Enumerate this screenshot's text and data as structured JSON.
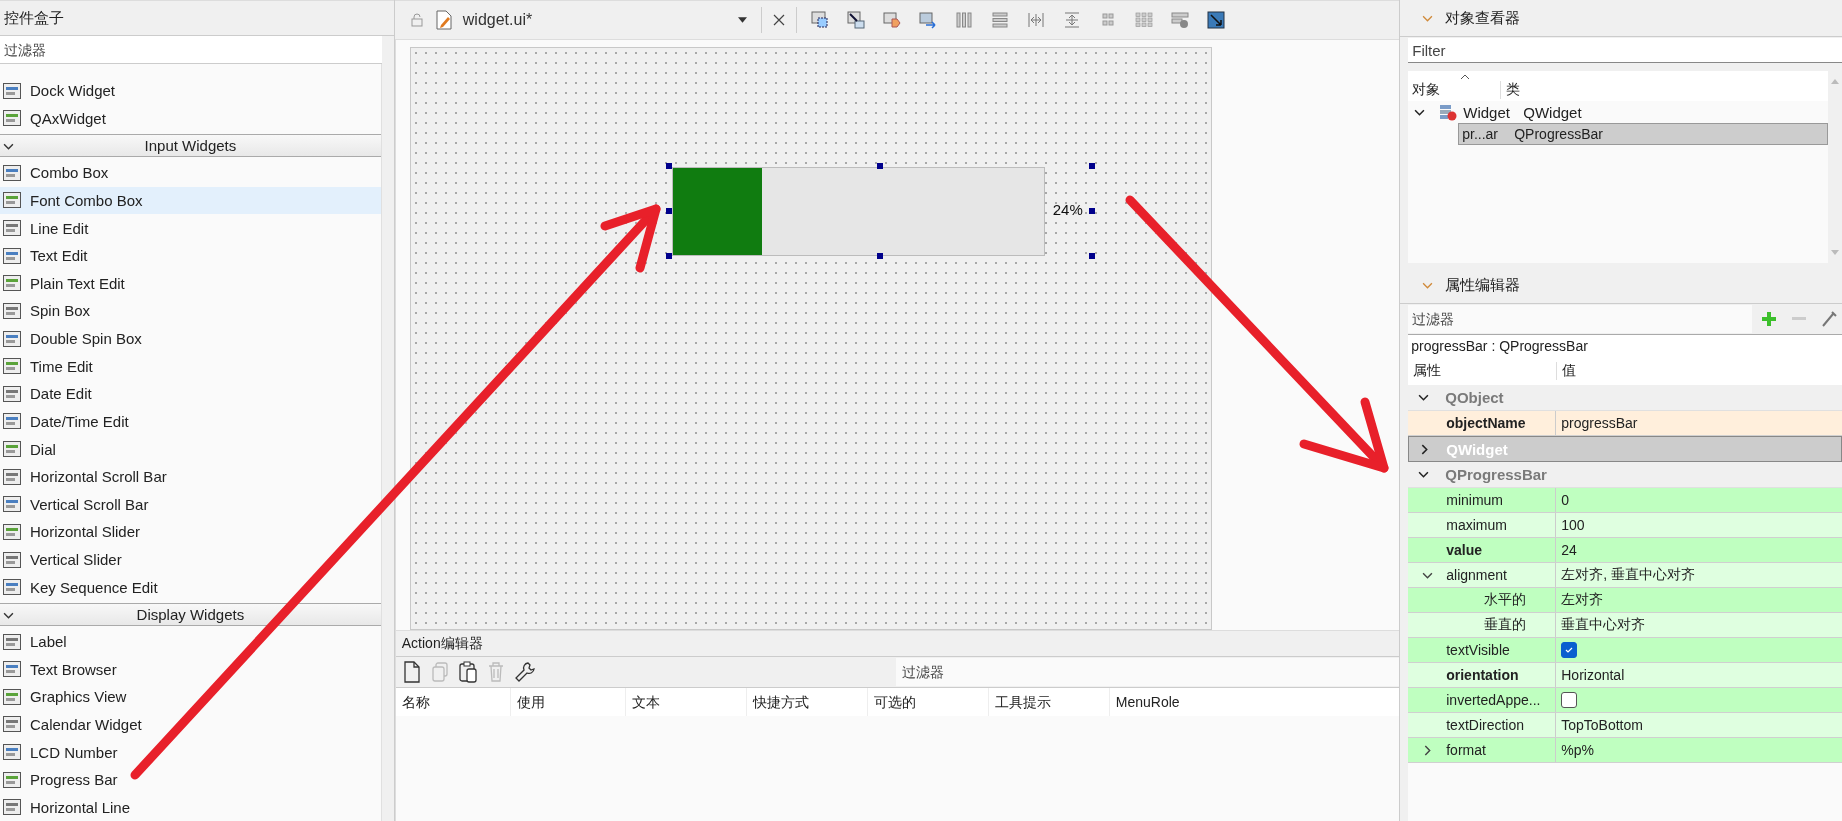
{
  "widget_box": {
    "title": "控件盒子",
    "filter_placeholder": "过滤器",
    "items": [
      {
        "kind": "widget",
        "label": "Dock Widget",
        "selected": false
      },
      {
        "kind": "widget",
        "label": "QAxWidget",
        "selected": false
      },
      {
        "kind": "category",
        "label": "Input Widgets",
        "expanded": true
      },
      {
        "kind": "widget",
        "label": "Combo Box",
        "selected": false
      },
      {
        "kind": "widget",
        "label": "Font Combo Box",
        "selected": true
      },
      {
        "kind": "widget",
        "label": "Line Edit",
        "selected": false
      },
      {
        "kind": "widget",
        "label": "Text Edit",
        "selected": false
      },
      {
        "kind": "widget",
        "label": "Plain Text Edit",
        "selected": false
      },
      {
        "kind": "widget",
        "label": "Spin Box",
        "selected": false
      },
      {
        "kind": "widget",
        "label": "Double Spin Box",
        "selected": false
      },
      {
        "kind": "widget",
        "label": "Time Edit",
        "selected": false
      },
      {
        "kind": "widget",
        "label": "Date Edit",
        "selected": false
      },
      {
        "kind": "widget",
        "label": "Date/Time Edit",
        "selected": false
      },
      {
        "kind": "widget",
        "label": "Dial",
        "selected": false
      },
      {
        "kind": "widget",
        "label": "Horizontal Scroll Bar",
        "selected": false
      },
      {
        "kind": "widget",
        "label": "Vertical Scroll Bar",
        "selected": false
      },
      {
        "kind": "widget",
        "label": "Horizontal Slider",
        "selected": false
      },
      {
        "kind": "widget",
        "label": "Vertical Slider",
        "selected": false
      },
      {
        "kind": "widget",
        "label": "Key Sequence Edit",
        "selected": false
      },
      {
        "kind": "category",
        "label": "Display Widgets",
        "expanded": true
      },
      {
        "kind": "widget",
        "label": "Label",
        "selected": false
      },
      {
        "kind": "widget",
        "label": "Text Browser",
        "selected": false
      },
      {
        "kind": "widget",
        "label": "Graphics View",
        "selected": false
      },
      {
        "kind": "widget",
        "label": "Calendar Widget",
        "selected": false
      },
      {
        "kind": "widget",
        "label": "LCD Number",
        "selected": false
      },
      {
        "kind": "widget",
        "label": "Progress Bar",
        "selected": false
      },
      {
        "kind": "widget",
        "label": "Horizontal Line",
        "selected": false
      }
    ]
  },
  "editor_tab": {
    "file": "widget.ui*"
  },
  "form": {
    "progress_bar": {
      "level": 0.24,
      "text": "24%"
    }
  },
  "action_editor": {
    "title": "Action编辑器",
    "filter_placeholder": "过滤器",
    "columns": [
      "名称",
      "使用",
      "文本",
      "快捷方式",
      "可选的",
      "工具提示",
      "MenuRole"
    ]
  },
  "object_inspector": {
    "title": "对象查看器",
    "filter_placeholder": "Filter",
    "columns": [
      "对象",
      "类"
    ],
    "tree": [
      {
        "object": "Widget",
        "class": "QWidget",
        "expanded": true,
        "selected": false,
        "children": [
          {
            "object": "pr...ar",
            "class": "QProgressBar",
            "selected": true
          }
        ]
      }
    ]
  },
  "property_editor": {
    "title": "属性编辑器",
    "filter_placeholder": "过滤器",
    "object_label": "progressBar : QProgressBar",
    "columns": [
      "属性",
      "值"
    ],
    "groups": [
      {
        "name": "QObject",
        "expanded": true,
        "selected": false,
        "color": "#ffefdc",
        "properties": [
          {
            "name": "objectName",
            "kind": "text",
            "value": "progressBar",
            "modified": true
          }
        ]
      },
      {
        "name": "QWidget",
        "expanded": false,
        "selected": true
      },
      {
        "name": "QProgressBar",
        "expanded": true,
        "selected": false,
        "color": "#bfffc0",
        "properties": [
          {
            "name": "minimum",
            "kind": "text",
            "value": "0",
            "modified": false
          },
          {
            "name": "maximum",
            "kind": "text",
            "value": "100",
            "modified": false
          },
          {
            "name": "value",
            "kind": "text",
            "value": "24",
            "modified": true
          },
          {
            "name": "alignment",
            "kind": "text",
            "value": "左对齐, 垂直中心对齐",
            "modified": false,
            "expanded": true,
            "children": [
              {
                "name": "水平的",
                "kind": "text",
                "value": "左对齐",
                "modified": false
              },
              {
                "name": "垂直的",
                "kind": "text",
                "value": "垂直中心对齐",
                "modified": false
              }
            ]
          },
          {
            "name": "textVisible",
            "kind": "checkbox",
            "checked": true,
            "modified": false
          },
          {
            "name": "orientation",
            "kind": "text",
            "value": "Horizontal",
            "modified": true
          },
          {
            "name": "invertedAppe...",
            "kind": "checkbox",
            "checked": false,
            "modified": false
          },
          {
            "name": "textDirection",
            "kind": "text",
            "value": "TopToBottom",
            "modified": false
          },
          {
            "name": "format",
            "kind": "text",
            "value": "%p%",
            "modified": false,
            "expanded": false
          }
        ]
      }
    ]
  }
}
